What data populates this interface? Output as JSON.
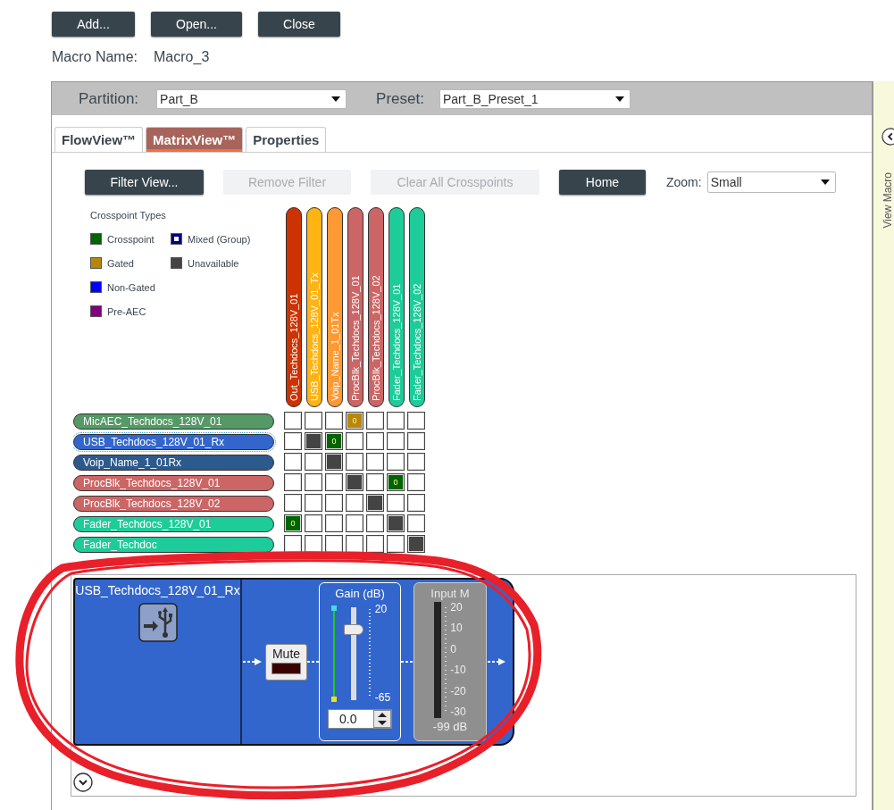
{
  "toolbar": {
    "buttons": [
      "Add...",
      "Open...",
      "Close"
    ]
  },
  "macro": {
    "label": "Macro Name:",
    "value": "Macro_3"
  },
  "header": {
    "partition": {
      "label": "Partition:",
      "value": "Part_B"
    },
    "preset": {
      "label": "Preset:",
      "value": "Part_B_Preset_1"
    }
  },
  "tabs": [
    {
      "label": "FlowView™",
      "selected": false
    },
    {
      "label": "MatrixView™",
      "selected": true
    },
    {
      "label": "Properties",
      "selected": false
    }
  ],
  "matrix_toolbar": {
    "buttons": [
      {
        "label": "Filter View...",
        "disabled": false
      },
      {
        "label": "Remove Filter",
        "disabled": true
      },
      {
        "label": "Clear All Crosspoints",
        "disabled": true
      },
      {
        "label": "Home",
        "disabled": false
      }
    ],
    "zoom": {
      "label": "Zoom:",
      "value": "Small"
    }
  },
  "legend": {
    "title": "Crosspoint Types",
    "items": [
      {
        "label": "Crosspoint",
        "kind": "solid",
        "color": "#006400"
      },
      {
        "label": "Mixed (Group)",
        "kind": "mixed",
        "color": "#000080"
      },
      {
        "label": "Gated",
        "kind": "solid",
        "color": "#b8860b"
      },
      {
        "label": "Unavailable",
        "kind": "solid",
        "color": "#444444"
      },
      {
        "label": "Non-Gated",
        "kind": "solid",
        "color": "#0000ff"
      },
      {
        "label": "Pre-AEC",
        "kind": "solid",
        "color": "#800080"
      }
    ]
  },
  "outputs": [
    {
      "name": "Out_Techdocs_128V_01",
      "color": "#cc3300"
    },
    {
      "name": "USB_Techdocs_128V_01_Tx",
      "color": "#ffb414"
    },
    {
      "name": "Voip_Name_1_01Tx",
      "color": "#ff9933"
    },
    {
      "name": "ProcBlk_Techdocs_128V_01",
      "color": "#cc6666"
    },
    {
      "name": "ProcBlk_Techdocs_128V_02",
      "color": "#cc6666"
    },
    {
      "name": "Fader_Techdocs_128V_01",
      "color": "#1ecc99"
    },
    {
      "name": "Fader_Techdocs_128V_02",
      "color": "#1ecc99"
    }
  ],
  "inputs": [
    {
      "name": "MicAEC_Techdocs_128V_01",
      "color": "#559966",
      "selected": false,
      "cells": [
        {
          "kind": "empty"
        },
        {
          "kind": "empty"
        },
        {
          "kind": "empty"
        },
        {
          "kind": "gated",
          "text": "0"
        },
        {
          "kind": "empty"
        },
        {
          "kind": "empty"
        },
        {
          "kind": "empty"
        }
      ]
    },
    {
      "name": "USB_Techdocs_128V_01_Rx",
      "color": "#3366cc",
      "selected": true,
      "cells": [
        {
          "kind": "empty"
        },
        {
          "kind": "unavailable"
        },
        {
          "kind": "crosspoint",
          "text": "0"
        },
        {
          "kind": "empty"
        },
        {
          "kind": "empty"
        },
        {
          "kind": "empty"
        },
        {
          "kind": "empty"
        }
      ]
    },
    {
      "name": "Voip_Name_1_01Rx",
      "color": "#2d5a8c",
      "selected": false,
      "cells": [
        {
          "kind": "empty"
        },
        {
          "kind": "empty"
        },
        {
          "kind": "unavailable"
        },
        {
          "kind": "empty"
        },
        {
          "kind": "empty"
        },
        {
          "kind": "empty"
        },
        {
          "kind": "empty"
        }
      ]
    },
    {
      "name": "ProcBlk_Techdocs_128V_01",
      "color": "#cc6666",
      "selected": false,
      "cells": [
        {
          "kind": "empty"
        },
        {
          "kind": "empty"
        },
        {
          "kind": "empty"
        },
        {
          "kind": "unavailable"
        },
        {
          "kind": "empty"
        },
        {
          "kind": "crosspoint",
          "text": "0"
        },
        {
          "kind": "empty"
        }
      ]
    },
    {
      "name": "ProcBlk_Techdocs_128V_02",
      "color": "#cc6666",
      "selected": false,
      "cells": [
        {
          "kind": "empty"
        },
        {
          "kind": "empty"
        },
        {
          "kind": "empty"
        },
        {
          "kind": "empty"
        },
        {
          "kind": "unavailable"
        },
        {
          "kind": "empty"
        },
        {
          "kind": "empty"
        }
      ]
    },
    {
      "name": "Fader_Techdocs_128V_01",
      "color": "#1ecc99",
      "selected": false,
      "cells": [
        {
          "kind": "crosspoint",
          "text": "0"
        },
        {
          "kind": "empty"
        },
        {
          "kind": "empty"
        },
        {
          "kind": "empty"
        },
        {
          "kind": "empty"
        },
        {
          "kind": "unavailable"
        },
        {
          "kind": "empty"
        }
      ]
    },
    {
      "name": "Fader_Techdoc",
      "color": "#1ecc99",
      "selected": false,
      "cells": [
        {
          "kind": "empty"
        },
        {
          "kind": "empty"
        },
        {
          "kind": "empty"
        },
        {
          "kind": "empty"
        },
        {
          "kind": "empty"
        },
        {
          "kind": "empty"
        },
        {
          "kind": "unavailable"
        }
      ]
    }
  ],
  "block": {
    "title": "USB_Techdocs_128V_01_Rx",
    "mute": {
      "label": "Mute",
      "on": false
    },
    "gain": {
      "title": "Gain (dB)",
      "max": "20",
      "min": "-65",
      "level": 0.76,
      "value": "0.0"
    },
    "meter": {
      "title": "Input M",
      "scale": [
        "20",
        "10",
        "0",
        "-10",
        "-20",
        "-30"
      ],
      "reading": "-99 dB"
    }
  },
  "side_pane": {
    "label": "View Macro"
  }
}
